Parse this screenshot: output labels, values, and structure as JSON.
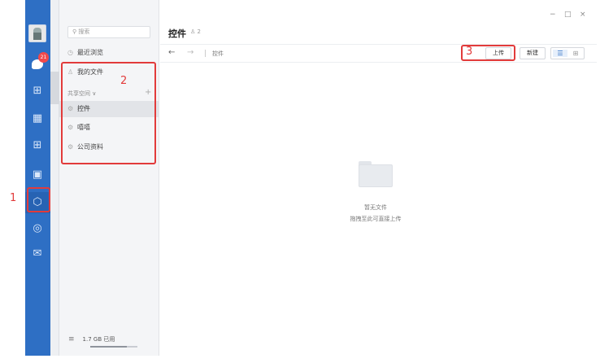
{
  "rail": {
    "chat_badge": "21",
    "icons": [
      "chat-icon",
      "org-chart-icon",
      "calendar-icon",
      "apps-grid-icon",
      "doc-icon",
      "drive-icon",
      "cloud-icon",
      "mail-icon"
    ]
  },
  "sidebar": {
    "search_placeholder": "搜索",
    "recent": "最近浏览",
    "my_files": "我的文件",
    "shared_space": "共享空间 ∨",
    "spaces": [
      "控件",
      "嘻嘻",
      "公司资料"
    ],
    "storage": "1.7 GB 已用",
    "storage_fraction": 0.78
  },
  "main": {
    "title": "控件",
    "member_count": "2",
    "breadcrumb": "控件",
    "upload_label": "上传",
    "new_label": "新建",
    "empty_title": "暂无文件",
    "empty_hint": "拖拽至此可直接上传"
  },
  "annotations": [
    "1",
    "2",
    "3"
  ],
  "colors": {
    "rail": "#2e6fc4",
    "annotation": "#e23b3b",
    "badge": "#f2494b"
  }
}
